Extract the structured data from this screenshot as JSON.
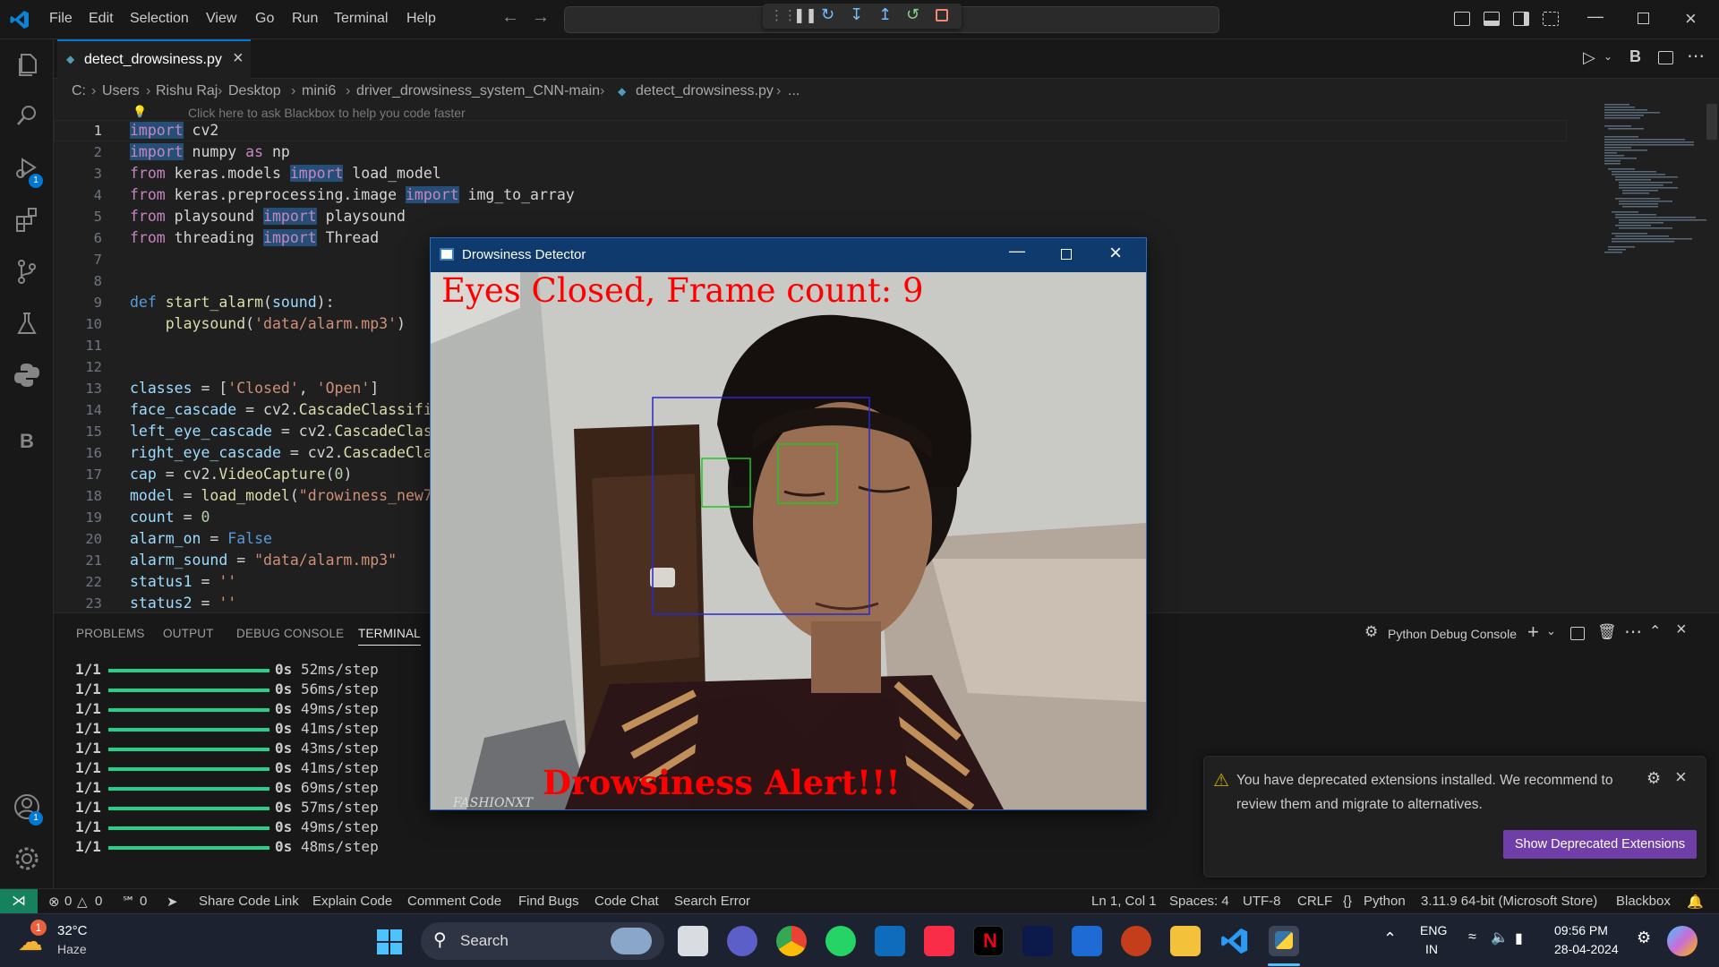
{
  "menu": {
    "file": "File",
    "edit": "Edit",
    "selection": "Selection",
    "view": "View",
    "go": "Go",
    "run": "Run",
    "terminal": "Terminal",
    "help": "Help"
  },
  "tab": {
    "filename": "detect_drowsiness.py"
  },
  "breadcrumb": [
    "C:",
    "Users",
    "Rishu Raj",
    "Desktop",
    "mini6",
    "driver_drowsiness_system_CNN-main",
    "detect_drowsiness.py",
    "..."
  ],
  "editor": {
    "hint": "Click here to ask Blackbox to help you code faster",
    "line_numbers": [
      "1",
      "2",
      "3",
      "4",
      "5",
      "6",
      "7",
      "8",
      "9",
      "10",
      "11",
      "12",
      "13",
      "14",
      "15",
      "16",
      "17",
      "18",
      "19",
      "20",
      "21",
      "22",
      "23"
    ],
    "current_line": "1"
  },
  "panel": {
    "tabs": {
      "problems": "PROBLEMS",
      "output": "OUTPUT",
      "debug_console": "DEBUG CONSOLE",
      "terminal": "TERMINAL"
    },
    "console_name": "Python Debug Console",
    "terminal_rows": [
      {
        "step": "1/1",
        "time": "0s",
        "rate": "52ms/step"
      },
      {
        "step": "1/1",
        "time": "0s",
        "rate": "56ms/step"
      },
      {
        "step": "1/1",
        "time": "0s",
        "rate": "49ms/step"
      },
      {
        "step": "1/1",
        "time": "0s",
        "rate": "41ms/step"
      },
      {
        "step": "1/1",
        "time": "0s",
        "rate": "43ms/step"
      },
      {
        "step": "1/1",
        "time": "0s",
        "rate": "41ms/step"
      },
      {
        "step": "1/1",
        "time": "0s",
        "rate": "69ms/step"
      },
      {
        "step": "1/1",
        "time": "0s",
        "rate": "57ms/step"
      },
      {
        "step": "1/1",
        "time": "0s",
        "rate": "49ms/step"
      },
      {
        "step": "1/1",
        "time": "0s",
        "rate": "48ms/step"
      }
    ]
  },
  "notification": {
    "line1": "You have deprecated extensions installed. We recommend to",
    "line2": "review them and migrate to alternatives.",
    "button": "Show Deprecated Extensions"
  },
  "detector": {
    "title": "Drowsiness Detector",
    "top_text": "Eyes Closed, Frame count: 9",
    "alert_text": "Drowsiness Alert!!!",
    "shirt_text": "FASHIONXT"
  },
  "statusbar": {
    "errors": "0",
    "warnings": "0",
    "ports": "0",
    "share": "Share Code Link",
    "explain": "Explain Code",
    "comment": "Comment Code",
    "bugs": "Find Bugs",
    "chat": "Code Chat",
    "search": "Search Error",
    "position": "Ln 1, Col 1",
    "spaces": "Spaces: 4",
    "encoding": "UTF-8",
    "eol": "CRLF",
    "language": "Python",
    "interpreter": "3.11.9 64-bit (Microsoft Store)",
    "blackbox": "Blackbox"
  },
  "taskbar": {
    "weather_temp": "32°C",
    "weather_desc": "Haze",
    "weather_badge": "1",
    "search": "Search",
    "lang1": "ENG",
    "lang2": "IN",
    "time": "09:56 PM",
    "date": "28-04-2024"
  },
  "badges": {
    "debug": "1",
    "accounts": "1"
  },
  "colors": {
    "accent": "#0078d4",
    "terminal_bar": "#23d18b",
    "notif_button": "#6f3ea8",
    "alert": "#ff0000",
    "face_box": "#2828c8",
    "eye_box": "#22c422"
  }
}
